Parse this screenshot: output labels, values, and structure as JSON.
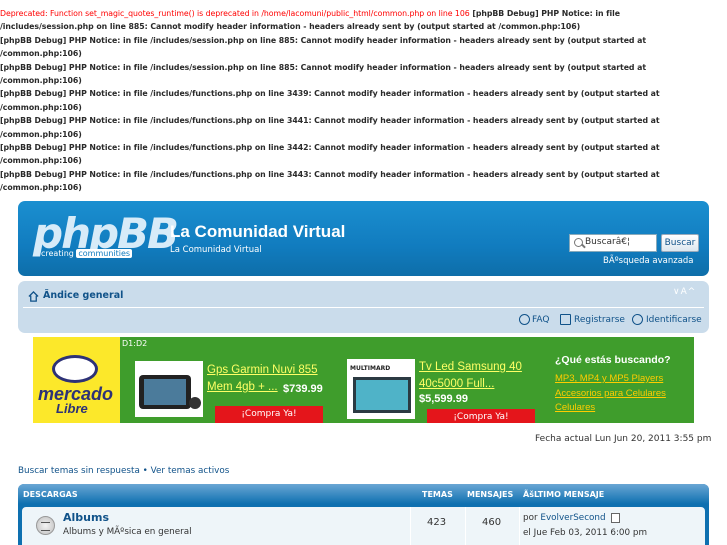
{
  "debug": {
    "deprecated": "Deprecated: Function set_magic_quotes_runtime() is deprecated in /home/lacomuni/public_html/common.php on line 106",
    "lines": [
      " [phpBB Debug] PHP Notice: in file",
      "/includes/session.php on line 885: Cannot modify header information - headers already sent by (output started at /common.php:106)",
      "[phpBB Debug] PHP Notice: in file /includes/session.php on line 885: Cannot modify header information - headers already sent by (output started at",
      "/common.php:106)",
      "[phpBB Debug] PHP Notice: in file /includes/session.php on line 885: Cannot modify header information - headers already sent by (output started at",
      "/common.php:106)",
      "[phpBB Debug] PHP Notice: in file /includes/functions.php on line 3439: Cannot modify header information - headers already sent by (output started at",
      "/common.php:106)",
      "[phpBB Debug] PHP Notice: in file /includes/functions.php on line 3441: Cannot modify header information - headers already sent by (output started at",
      "/common.php:106)",
      "[phpBB Debug] PHP Notice: in file /includes/functions.php on line 3442: Cannot modify header information - headers already sent by (output started at",
      "/common.php:106)",
      "[phpBB Debug] PHP Notice: in file /includes/functions.php on line 3443: Cannot modify header information - headers already sent by (output started at",
      "/common.php:106)"
    ]
  },
  "header": {
    "logo_word": "phpBB",
    "logo_tag_1": "creating",
    "logo_tag_2": "communities",
    "site_title": "La Comunidad Virtual",
    "site_desc": "La Comunidad Virtual",
    "search_placeholder": "Buscarâ€¦",
    "search_button": "Buscar",
    "advanced_search": "BÃºsqueda avanzada"
  },
  "navbar": {
    "home": "Ãndice general",
    "resize": "∨A^",
    "faq": "FAQ",
    "register": "Registrarse",
    "login": "Identificarse"
  },
  "ad": {
    "brand_1": "mercado",
    "brand_2": "Libre",
    "code": "D1:D2",
    "products": [
      {
        "title_1": "Gps Garmin Nuvi 855",
        "title_2": "Mem 4gb + ...",
        "price": "$739.99",
        "button": "¡Compra Ya!"
      },
      {
        "title_1": "Tv Led Samsung 40",
        "title_2": "40c5000 Full...",
        "price": "$5,599.99",
        "button": "¡Compra Ya!",
        "brand": "MULTIMARD"
      }
    ],
    "question": "¿Qué estás buscando?",
    "links": [
      "MP3, MP4 y MP5 Players",
      "Accesorios para Celulares",
      "Celulares"
    ]
  },
  "date": "Fecha actual Lun Jun 20, 2011 3:55 pm",
  "quick_links": {
    "unanswered": "Buscar temas sin respuesta",
    "sep": " • ",
    "active": "Ver temas activos"
  },
  "forum": {
    "headers": {
      "category": "DESCARGAS",
      "topics": "TEMAS",
      "posts": "MENSAJES",
      "last": "ÃšLTIMO MENSAJE"
    },
    "rows": [
      {
        "title": "Albums",
        "desc": "Albums y MÃºsica en general",
        "topics": "423",
        "posts": "460",
        "last_by_prefix": "por ",
        "last_by_user": "EvolverSecond",
        "last_date": "el Jue Feb 03, 2011 6:00 pm"
      }
    ]
  }
}
